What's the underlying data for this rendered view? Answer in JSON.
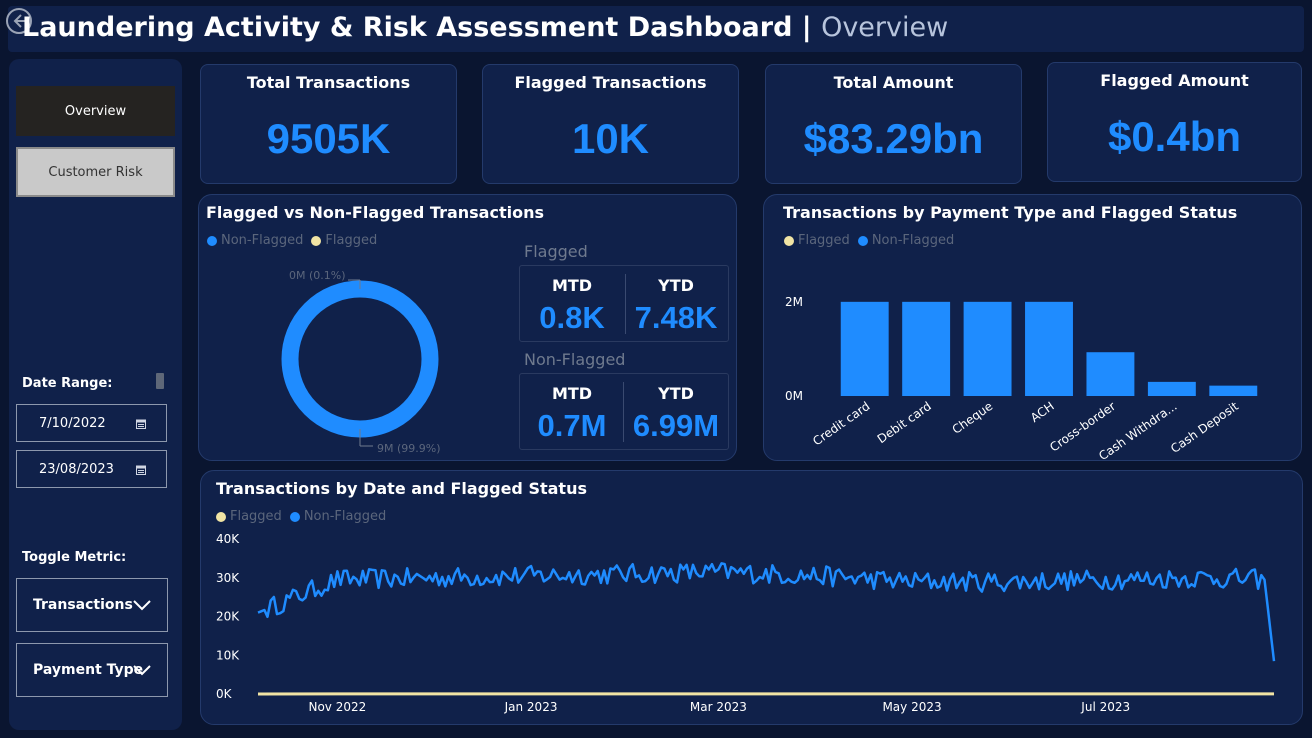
{
  "header": {
    "title": "Laundering Activity & Risk Assessment Dashboard |",
    "subtitle": "Overview"
  },
  "sidebar": {
    "nav": [
      {
        "label": "Overview"
      },
      {
        "label": "Customer Risk"
      }
    ],
    "date_range_label": "Date Range:",
    "date_start": "7/10/2022",
    "date_end": "23/08/2023",
    "toggle_label": "Toggle Metric:",
    "metric_dropdown": "Transactions",
    "category_dropdown": "Payment Type"
  },
  "kpis": [
    {
      "title": "Total Transactions",
      "value": "9505K"
    },
    {
      "title": "Flagged Transactions",
      "value": "10K"
    },
    {
      "title": "Total Amount",
      "value": "$83.29bn"
    },
    {
      "title": "Flagged Amount",
      "value": "$0.4bn"
    }
  ],
  "donut_panel": {
    "title": "Flagged vs Non-Flagged Transactions",
    "legend": [
      "Non-Flagged",
      "Flagged"
    ],
    "label_small": "0M (0.1%)",
    "label_large": "9M (99.9%)",
    "flagged_label": "Flagged",
    "flagged_mtd_label": "MTD",
    "flagged_mtd": "0.8K",
    "flagged_ytd_label": "YTD",
    "flagged_ytd": "7.48K",
    "nonflagged_label": "Non-Flagged",
    "nonflagged_mtd_label": "MTD",
    "nonflagged_mtd": "0.7M",
    "nonflagged_ytd_label": "YTD",
    "nonflagged_ytd": "6.99M"
  },
  "bar_panel": {
    "title": "Transactions by Payment Type and Flagged Status",
    "legend": [
      "Flagged",
      "Non-Flagged"
    ]
  },
  "line_panel": {
    "title": "Transactions by Date and Flagged Status",
    "legend": [
      "Flagged",
      "Non-Flagged"
    ]
  },
  "colors": {
    "background": "#0a1530",
    "panel": "#10214a",
    "accent_blue": "#1f8cff",
    "flagged_yellow": "#f1e4a4"
  },
  "chart_data": [
    {
      "type": "pie",
      "variant": "donut",
      "categories": [
        "Non-Flagged",
        "Flagged"
      ],
      "values": [
        99.9,
        0.1
      ],
      "value_labels": [
        "9M (99.9%)",
        "0M (0.1%)"
      ],
      "legend_placement": "top-left"
    },
    {
      "type": "bar",
      "categories": [
        "Credit card",
        "Debit card",
        "Cheque",
        "ACH",
        "Cross-border",
        "Cash Withdra...",
        "Cash Deposit"
      ],
      "series": [
        {
          "name": "Non-Flagged",
          "values": [
            2000000,
            2000000,
            2000000,
            2000000,
            930000,
            300000,
            220000
          ]
        },
        {
          "name": "Flagged",
          "values": [
            0,
            0,
            0,
            0,
            0,
            0,
            0
          ]
        }
      ],
      "ytick_labels": [
        "0M",
        "2M"
      ],
      "ylim": [
        0,
        2400000
      ],
      "legend_placement": "top-left"
    },
    {
      "type": "line",
      "x": [
        "2022-10-07",
        "2022-11-01",
        "2022-12-01",
        "2023-01-01",
        "2023-02-01",
        "2023-03-01",
        "2023-04-01",
        "2023-05-01",
        "2023-06-01",
        "2023-07-01",
        "2023-08-01",
        "2023-08-20",
        "2023-08-23"
      ],
      "xtick_labels": [
        "Nov 2022",
        "Jan 2023",
        "Mar 2023",
        "May 2023",
        "Jul 2023"
      ],
      "series": [
        {
          "name": "Non-Flagged",
          "values": [
            21000,
            29500,
            30000,
            30500,
            31000,
            31500,
            30500,
            29000,
            29000,
            29500,
            30000,
            29500,
            8500
          ]
        },
        {
          "name": "Flagged",
          "values": [
            0,
            30,
            30,
            30,
            30,
            30,
            30,
            30,
            30,
            30,
            30,
            30,
            30
          ]
        }
      ],
      "ytick_labels": [
        "0K",
        "10K",
        "20K",
        "30K",
        "40K"
      ],
      "ylim": [
        0,
        40000
      ],
      "legend_placement": "top-left"
    }
  ]
}
